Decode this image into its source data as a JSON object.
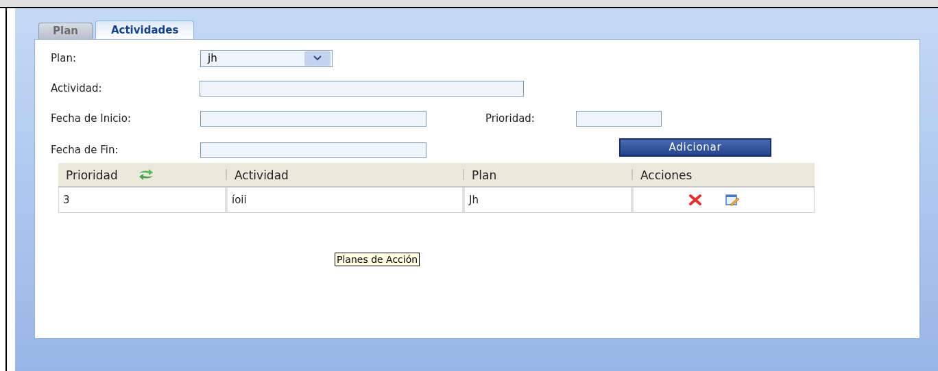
{
  "tabs": [
    {
      "label": "Plan",
      "selected": false
    },
    {
      "label": "Actividades",
      "selected": true
    }
  ],
  "form": {
    "plan_label": "Plan:",
    "plan_value": "jh",
    "actividad_label": "Actividad:",
    "fecha_inicio_label": "Fecha de Inicio:",
    "prioridad_label": "Prioridad:",
    "fecha_fin_label": "Fecha de Fin:",
    "add_button": "Adicionar"
  },
  "table": {
    "columns": [
      "Prioridad",
      "Actividad",
      "Plan",
      "Acciones"
    ],
    "rows": [
      {
        "prioridad": "3",
        "actividad": "íoii",
        "plan": "Jh"
      }
    ]
  },
  "tooltip": "Planes de Acción"
}
